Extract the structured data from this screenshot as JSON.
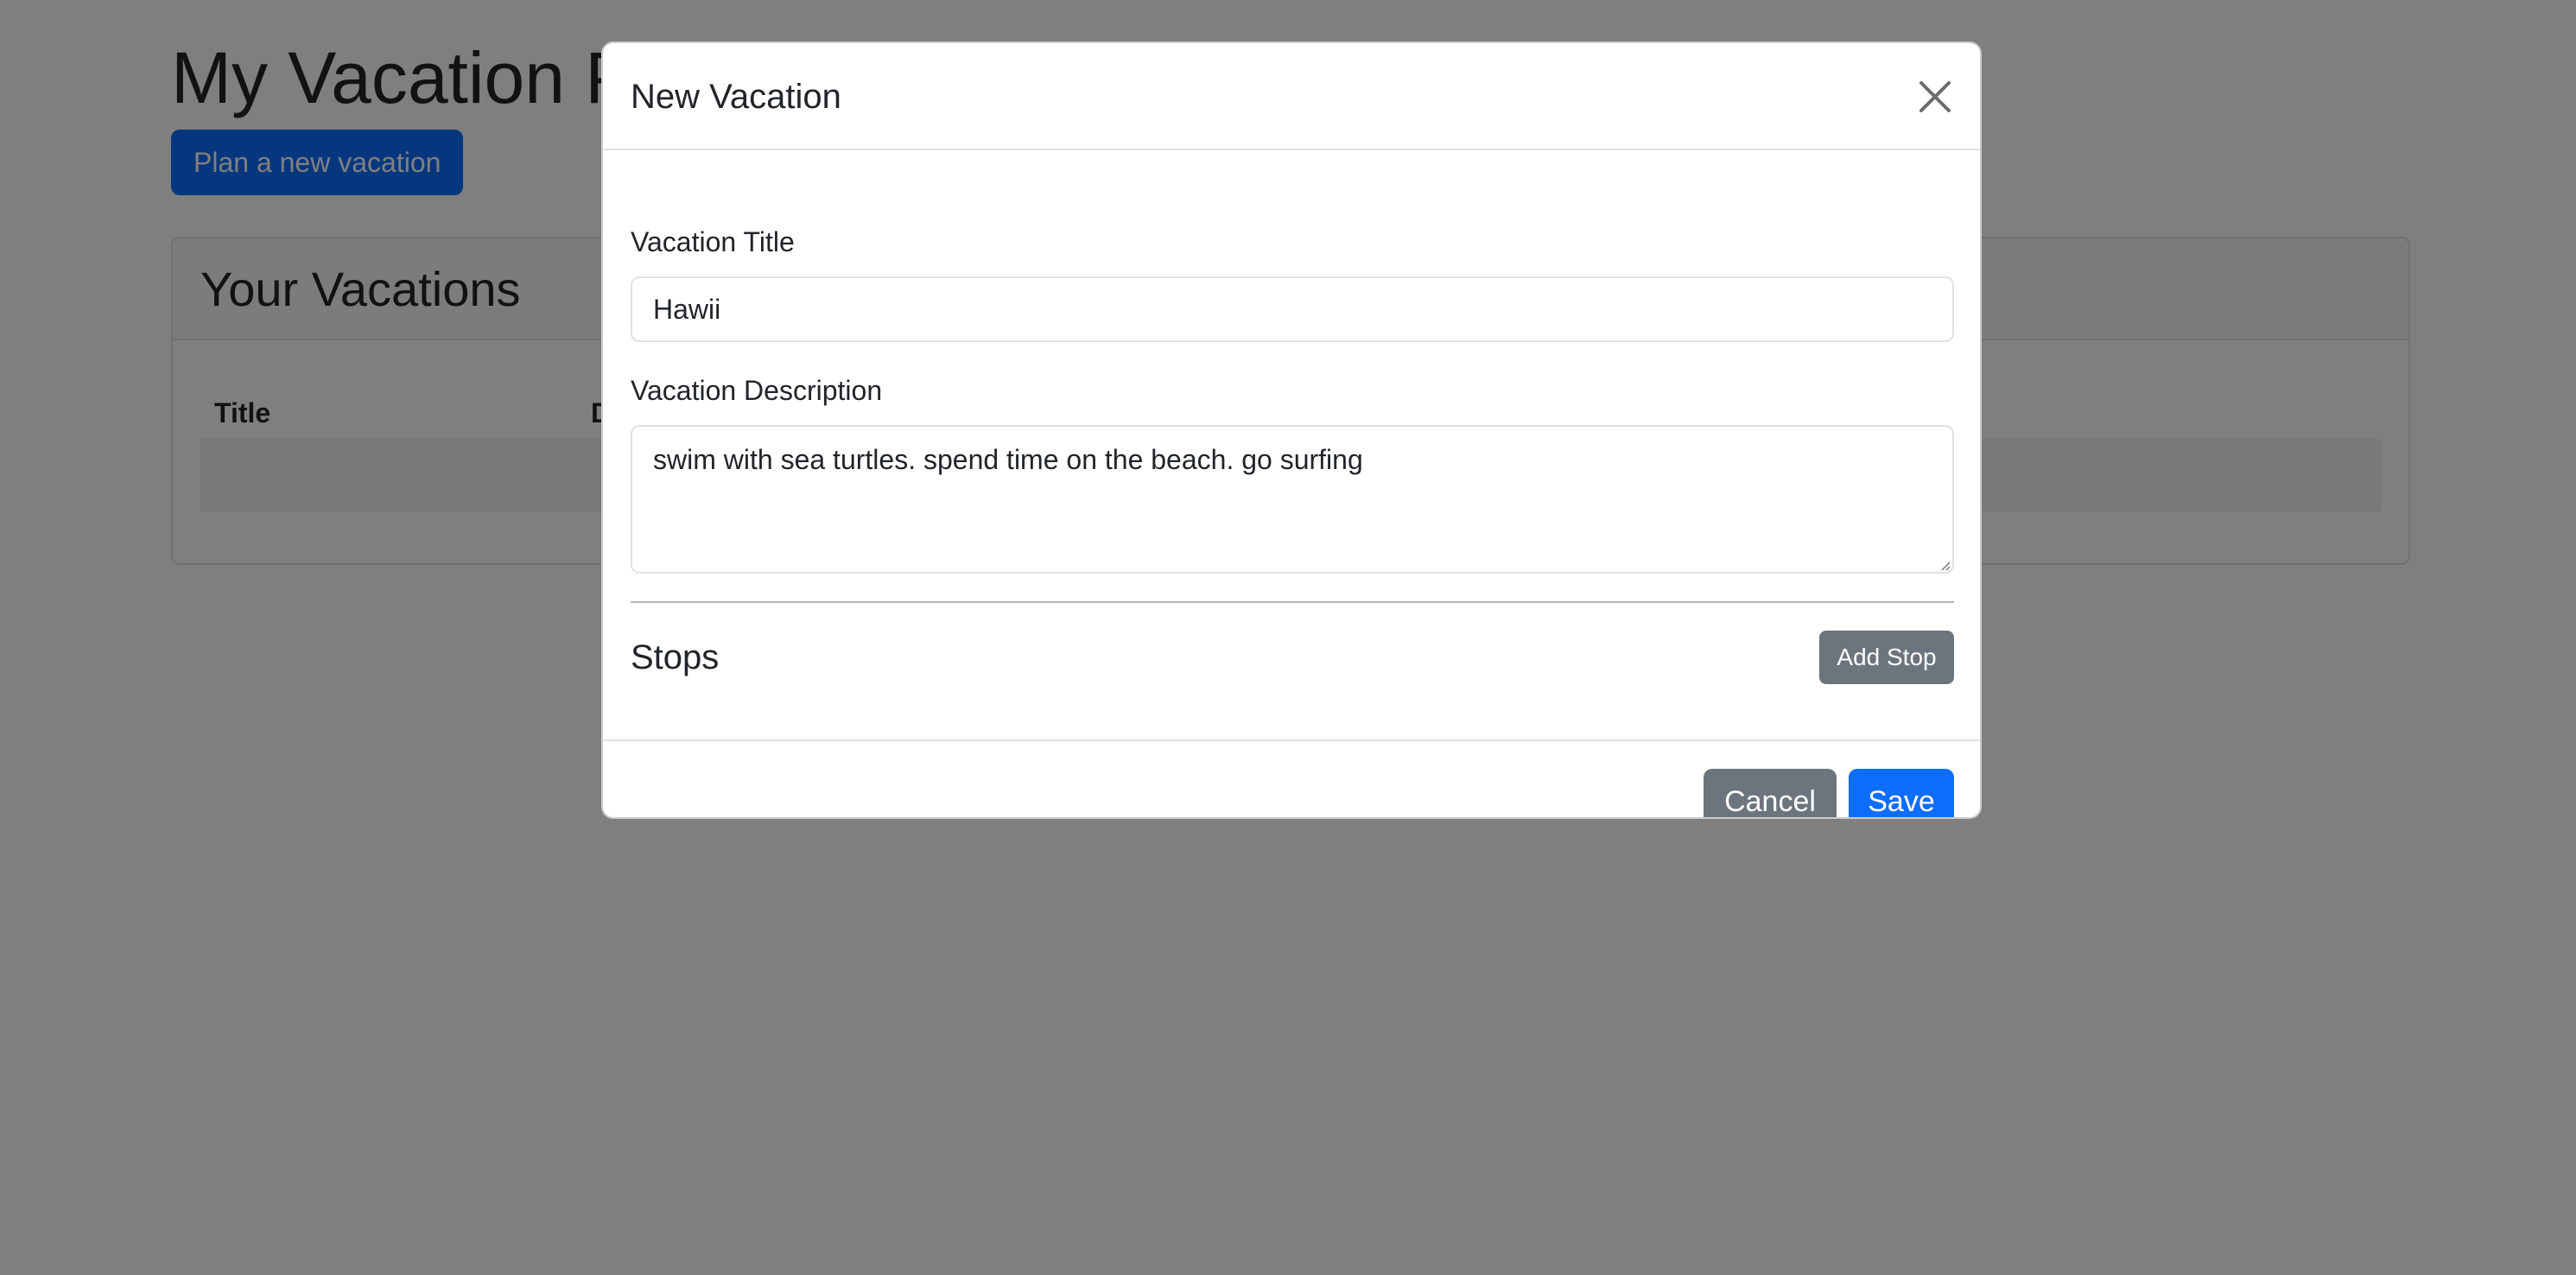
{
  "page": {
    "title": "My Vacation P",
    "plan_button_label": "Plan a new vacation",
    "vacations_card": {
      "title": "Your Vacations",
      "columns": [
        "Title",
        "D"
      ]
    }
  },
  "modal": {
    "title": "New Vacation",
    "close_icon": "close-icon",
    "vacation_title": {
      "label": "Vacation Title",
      "value": "Hawii"
    },
    "vacation_description": {
      "label": "Vacation Description",
      "value": "swim with sea turtles. spend time on the beach. go surfing"
    },
    "stops": {
      "heading": "Stops",
      "add_stop_label": "Add Stop"
    },
    "footer": {
      "cancel_label": "Cancel",
      "save_label": "Save"
    }
  },
  "colors": {
    "primary": "#0d6efd",
    "secondary": "#6c757d",
    "backdrop": "rgba(0,0,0,0.5)"
  }
}
